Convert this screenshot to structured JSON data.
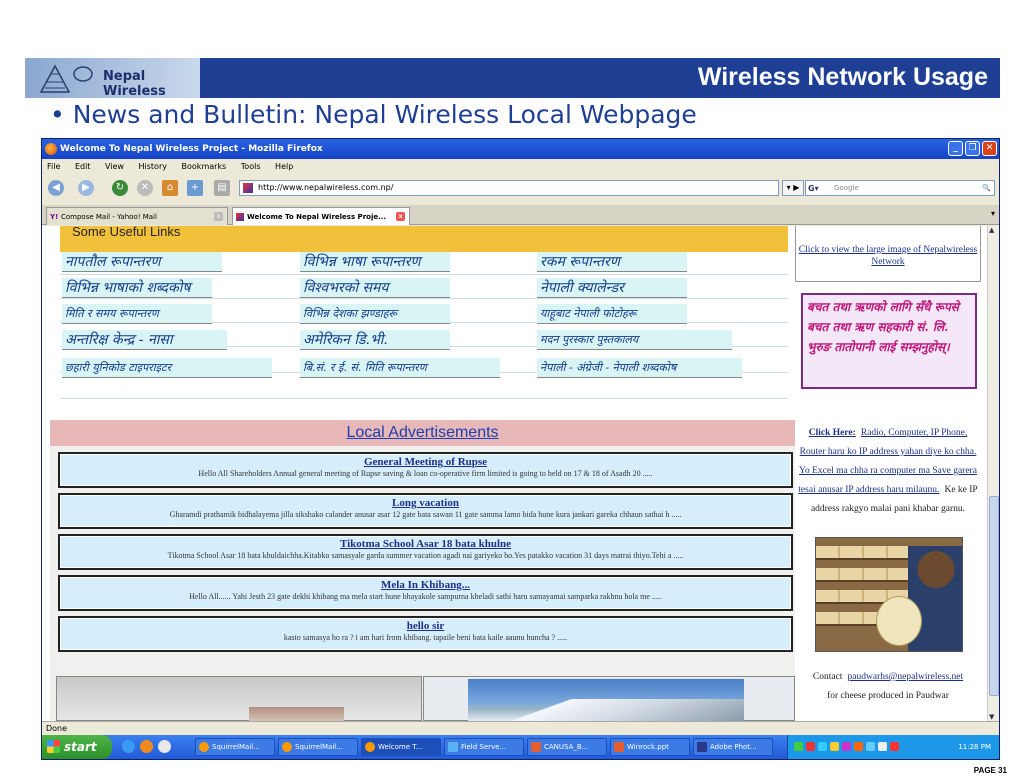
{
  "slide": {
    "logo_text": "Nepal Wireless",
    "title": "Wireless Network Usage",
    "bullet": "• News and Bulletin: Nepal Wireless Local Webpage",
    "page": "PAGE 31"
  },
  "browser": {
    "title": "Welcome To Nepal Wireless Project - Mozilla Firefox",
    "menu": [
      "File",
      "Edit",
      "View",
      "History",
      "Bookmarks",
      "Tools",
      "Help"
    ],
    "url": "http://www.nepalwireless.com.np/",
    "search_placeholder": "Google",
    "tabs": [
      "Compose Mail - Yahoo! Mail",
      "Welcome To Nepal Wireless Proje..."
    ],
    "status": "Done"
  },
  "page": {
    "links_heading": "Some Useful Links",
    "links": [
      "नापतौल रूपान्तरण",
      "विभिन्न भाषा रूपान्तरण",
      "रकम रूपान्तरण",
      "विभिन्न भाषाको शब्दकोष",
      "विश्वभरको समय",
      "नेपाली क्यालेन्डर",
      "मिति र समय रूपान्तरण",
      "विभिन्न देशका झण्डाहरू",
      "याहूबाट नेपाली फोटोहरू",
      "अन्तरिक्ष केन्द्र - नासा",
      "अमेरिकन डि.भी.",
      "मदन पुरस्कार पुस्तकालय",
      "छहारी युनिकोड टाइपराइटर",
      "बि.सं. र ई. सं. मिति रूपान्तरण",
      "नेपाली - अंग्रेजी - नेपाली शब्दकोष"
    ],
    "ads_heading": "Local Advertisements",
    "ads": [
      {
        "title": "General Meeting of Rupse",
        "body": "Hello All Shareholders Annual general meeting of Rupse saving & loan co-operative firm limited is going to held on 17 & 18 of Asadh 20 ....."
      },
      {
        "title": "Long vacation",
        "body": "Gharamdi prathamik bidhalayema jilla sikshako calander anusar asar 12 gate bata sawan 11 gate samma lamo bida hune kura jankari gareka chhaun sathai h ....."
      },
      {
        "title": "Tikotma School Asar 18 bata khulne",
        "body": "Tikotma School Asar 18 bata khuldaichha.Kitabko samasyale garda summer vacation agadi nai gariyeko ho.Yes patakko vacation 31 days matrai thiyo.Tehi a ....."
      },
      {
        "title": "Mela In Khibang...",
        "body": "Hello All...... Yahi Jesth 23 gate dekhi khibang ma mela start hune bhayakole sampurna kheladi sathi haru samayamai samparka rakhnu hola me ....."
      },
      {
        "title": "hello sir",
        "body": "kasto samasya ho ra ? i am hari from khibang. tapaile beni bata kaile aaunu huncha ? ....."
      }
    ],
    "side": {
      "large_image_link": "Click to view the large image of Nepalwireless Network",
      "banner": "बचत तथा ऋणको लागि सँधै रूपसे बचत तथा ऋण सहकारी सं. लि. भुरुङ तातोपानी लाई सम्झनुहोस्।",
      "click_here": "Click Here:",
      "click_link": "Radio, Computer, IP Phone, Router haru ko IP address yahan diye ko chha. Yo Excel ma chha ra computer ma Save garera tesai anusar IP address haru milaunu.",
      "click_after": "Ke ke IP address rakgyo malai pani khabar garnu.",
      "contact_prefix": "Contact",
      "contact_email": "paudwarhs@nepalwireless.net",
      "contact_suffix": "for cheese produced in Paudwar"
    }
  },
  "taskbar": {
    "start": "start",
    "items": [
      "SquirrelMail...",
      "SquirrelMail...",
      "Welcome T...",
      "Field Serve...",
      "CANUSA_B...",
      "Winrock.ppt",
      "Adobe Phot..."
    ],
    "clock": "11:28 PM"
  }
}
